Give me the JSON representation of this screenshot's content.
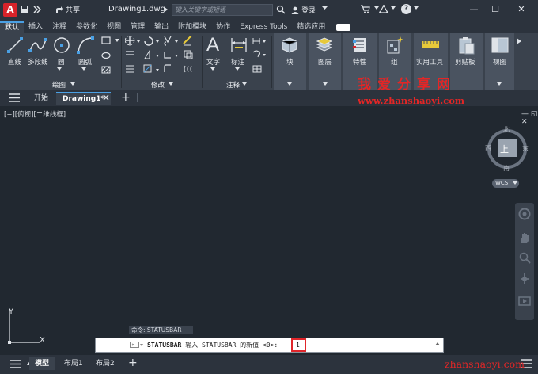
{
  "titlebar": {
    "logo": "A",
    "share_label": "共享",
    "document_title": "Drawing1.dwg",
    "search_placeholder": "键入关键字或短语",
    "login_label": "登录",
    "help_label": "?",
    "minimize": "—",
    "maximize": "☐",
    "close": "✕"
  },
  "ribbon_tabs": [
    {
      "label": "默认",
      "active": true
    },
    {
      "label": "插入"
    },
    {
      "label": "注释"
    },
    {
      "label": "参数化"
    },
    {
      "label": "视图"
    },
    {
      "label": "管理"
    },
    {
      "label": "输出"
    },
    {
      "label": "附加模块"
    },
    {
      "label": "协作"
    },
    {
      "label": "Express Tools"
    },
    {
      "label": "精选应用"
    }
  ],
  "ribbon": {
    "draw": {
      "line": "直线",
      "polyline": "多段线",
      "circle": "圆",
      "arc": "圆弧",
      "group": "绘图"
    },
    "modify": {
      "group": "修改"
    },
    "annotation": {
      "text": "文字",
      "dimension": "标注",
      "group": "注释"
    },
    "block": "块",
    "layers": "图层",
    "properties": "特性",
    "groups": "组",
    "utilities": "实用工具",
    "clipboard": "剪贴板",
    "view": "视图"
  },
  "file_tabs": {
    "menu_icon": "hamburger-icon",
    "start": "开始",
    "drawing": "Drawing1*",
    "add": "+"
  },
  "viewport": {
    "label": "[−][俯视][二维线框]",
    "viewcube": {
      "top_face": "上",
      "north": "北",
      "south": "南",
      "east": "东",
      "west": "西",
      "wcs": "WCS"
    },
    "ucs_x": "X",
    "ucs_y": "Y"
  },
  "command": {
    "history": "命令: STATUSBAR",
    "prompt_name": "STATUSBAR",
    "prompt_text": "输入 STATUSBAR 的新值 <0>:",
    "input_value": "1"
  },
  "status_tabs": {
    "model": "模型",
    "layout1": "布局1",
    "layout2": "布局2",
    "add": "+"
  },
  "watermark": {
    "line1": "我爱分享网",
    "line2": "www.zhanshaoyi.com",
    "line3": "zhanshaoyi.com"
  },
  "colors": {
    "accent": "#4aa0e4",
    "logo_red": "#d8232a",
    "watermark_red": "#e32626",
    "canvas": "#212830"
  }
}
